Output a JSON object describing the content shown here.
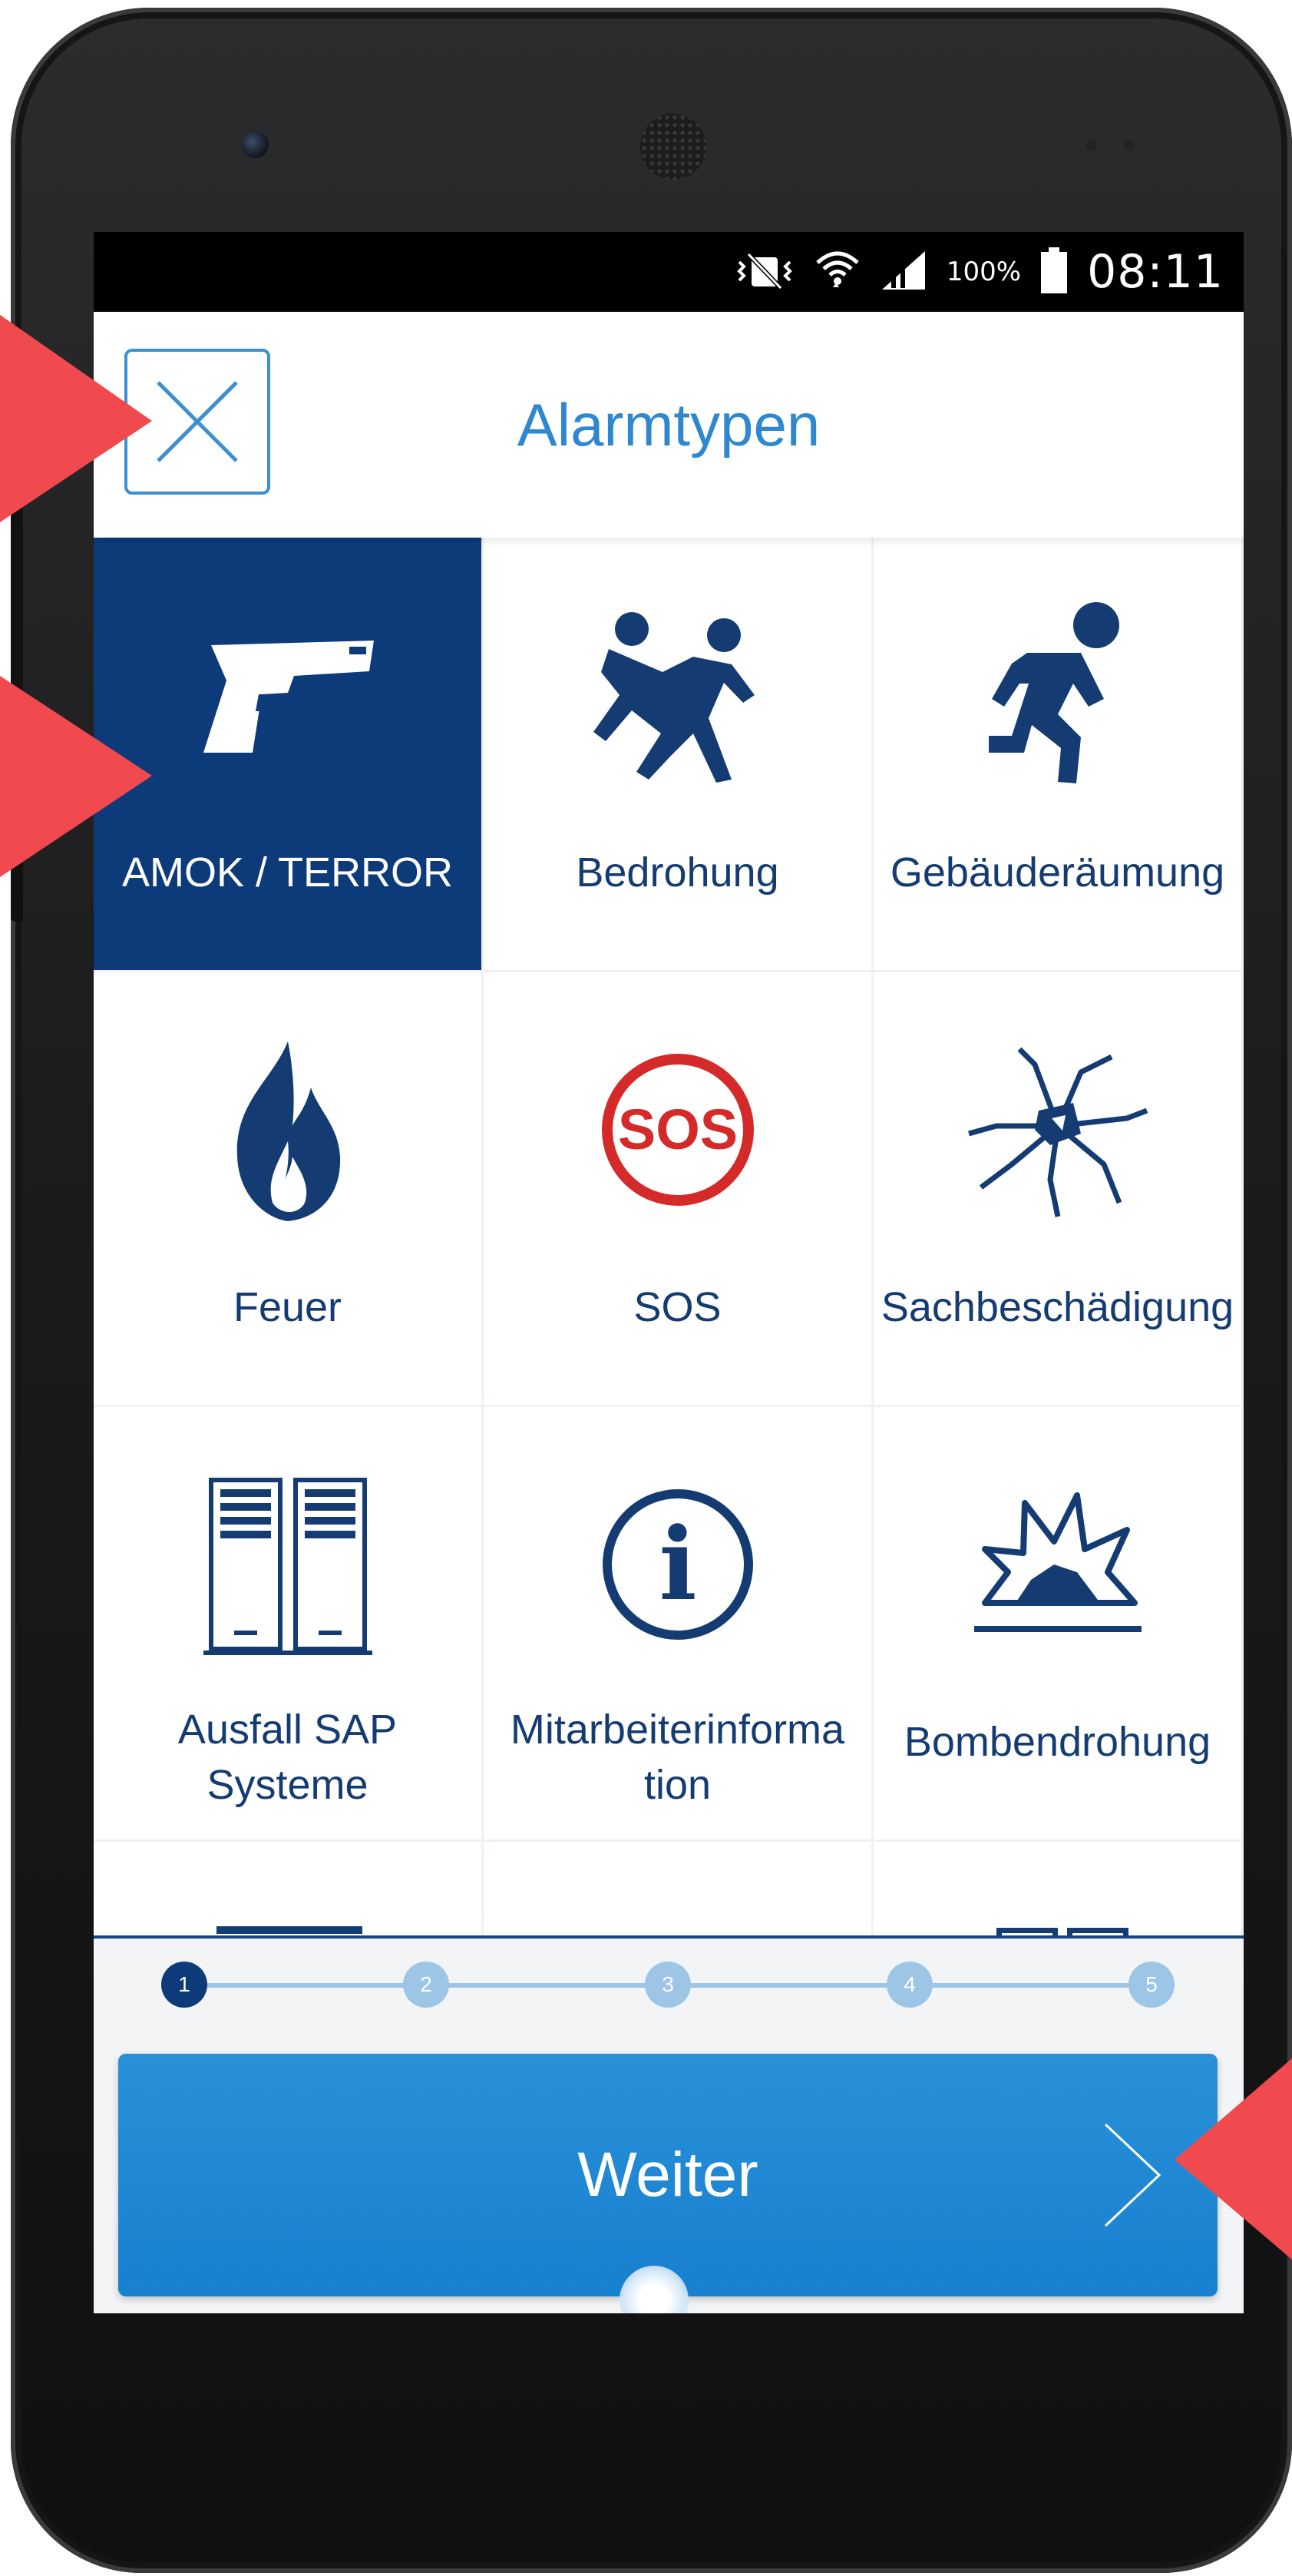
{
  "status_bar": {
    "battery": "100%",
    "time": "08:11"
  },
  "app_bar": {
    "title": "Alarmtypen"
  },
  "alarm_types": [
    {
      "label": "AMOK / TERROR",
      "icon": "pistol-icon",
      "selected": true
    },
    {
      "label": "Bedrohung",
      "icon": "fight-icon",
      "selected": false
    },
    {
      "label": "Gebäuderäumung",
      "icon": "running-person-icon",
      "selected": false
    },
    {
      "label": "Feuer",
      "icon": "fire-icon",
      "selected": false
    },
    {
      "label": "SOS",
      "icon": "sos-icon",
      "icon_text": "SOS",
      "selected": false
    },
    {
      "label": "Sachbeschädigung",
      "icon": "broken-glass-icon",
      "selected": false
    },
    {
      "label_line1": "Ausfall SAP",
      "label_line2": "Systeme",
      "icon": "server-rack-icon",
      "selected": false
    },
    {
      "label_line1": "Mitarbeiterinforma",
      "label_line2": "tion",
      "icon": "info-icon",
      "icon_text": "i",
      "selected": false
    },
    {
      "label": "Bombendrohung",
      "icon": "explosion-icon",
      "selected": false
    }
  ],
  "stepper": {
    "steps": [
      "1",
      "2",
      "3",
      "4",
      "5"
    ],
    "current_step": 1
  },
  "next_button": {
    "label": "Weiter"
  },
  "colors": {
    "accent": "#2f87cf",
    "selected_tile": "#0d3a78",
    "label": "#143c72",
    "annotation_arrow": "#f04a4e"
  }
}
